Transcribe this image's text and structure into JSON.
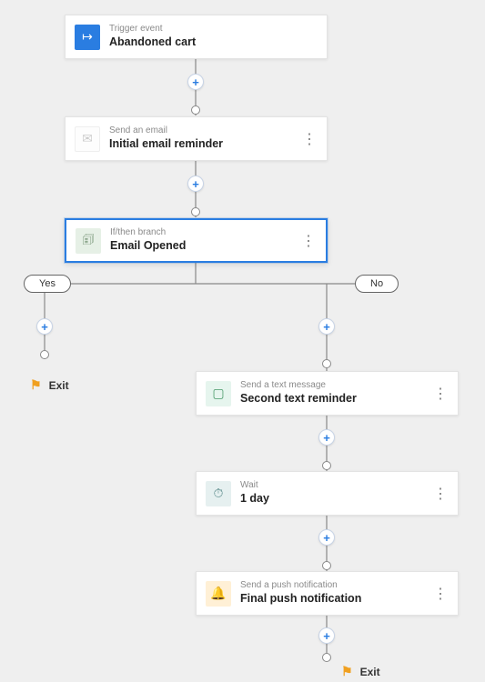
{
  "icons": {
    "trigger": "↦",
    "email": "✉",
    "branch": "🗊",
    "sms": "▢",
    "wait": "⏱",
    "push": "🔔",
    "flag": "⚑",
    "plus": "+",
    "kebab": "⋮"
  },
  "nodes": {
    "trigger": {
      "label": "Trigger event",
      "title": "Abandoned cart"
    },
    "email": {
      "label": "Send an email",
      "title": "Initial email reminder"
    },
    "branch": {
      "label": "If/then branch",
      "title": "Email Opened"
    },
    "sms": {
      "label": "Send a text message",
      "title": "Second text reminder"
    },
    "wait": {
      "label": "Wait",
      "title": "1 day"
    },
    "push": {
      "label": "Send a push notification",
      "title": "Final push notification"
    }
  },
  "branches": {
    "yes": "Yes",
    "no": "No"
  },
  "exitLabel": "Exit"
}
